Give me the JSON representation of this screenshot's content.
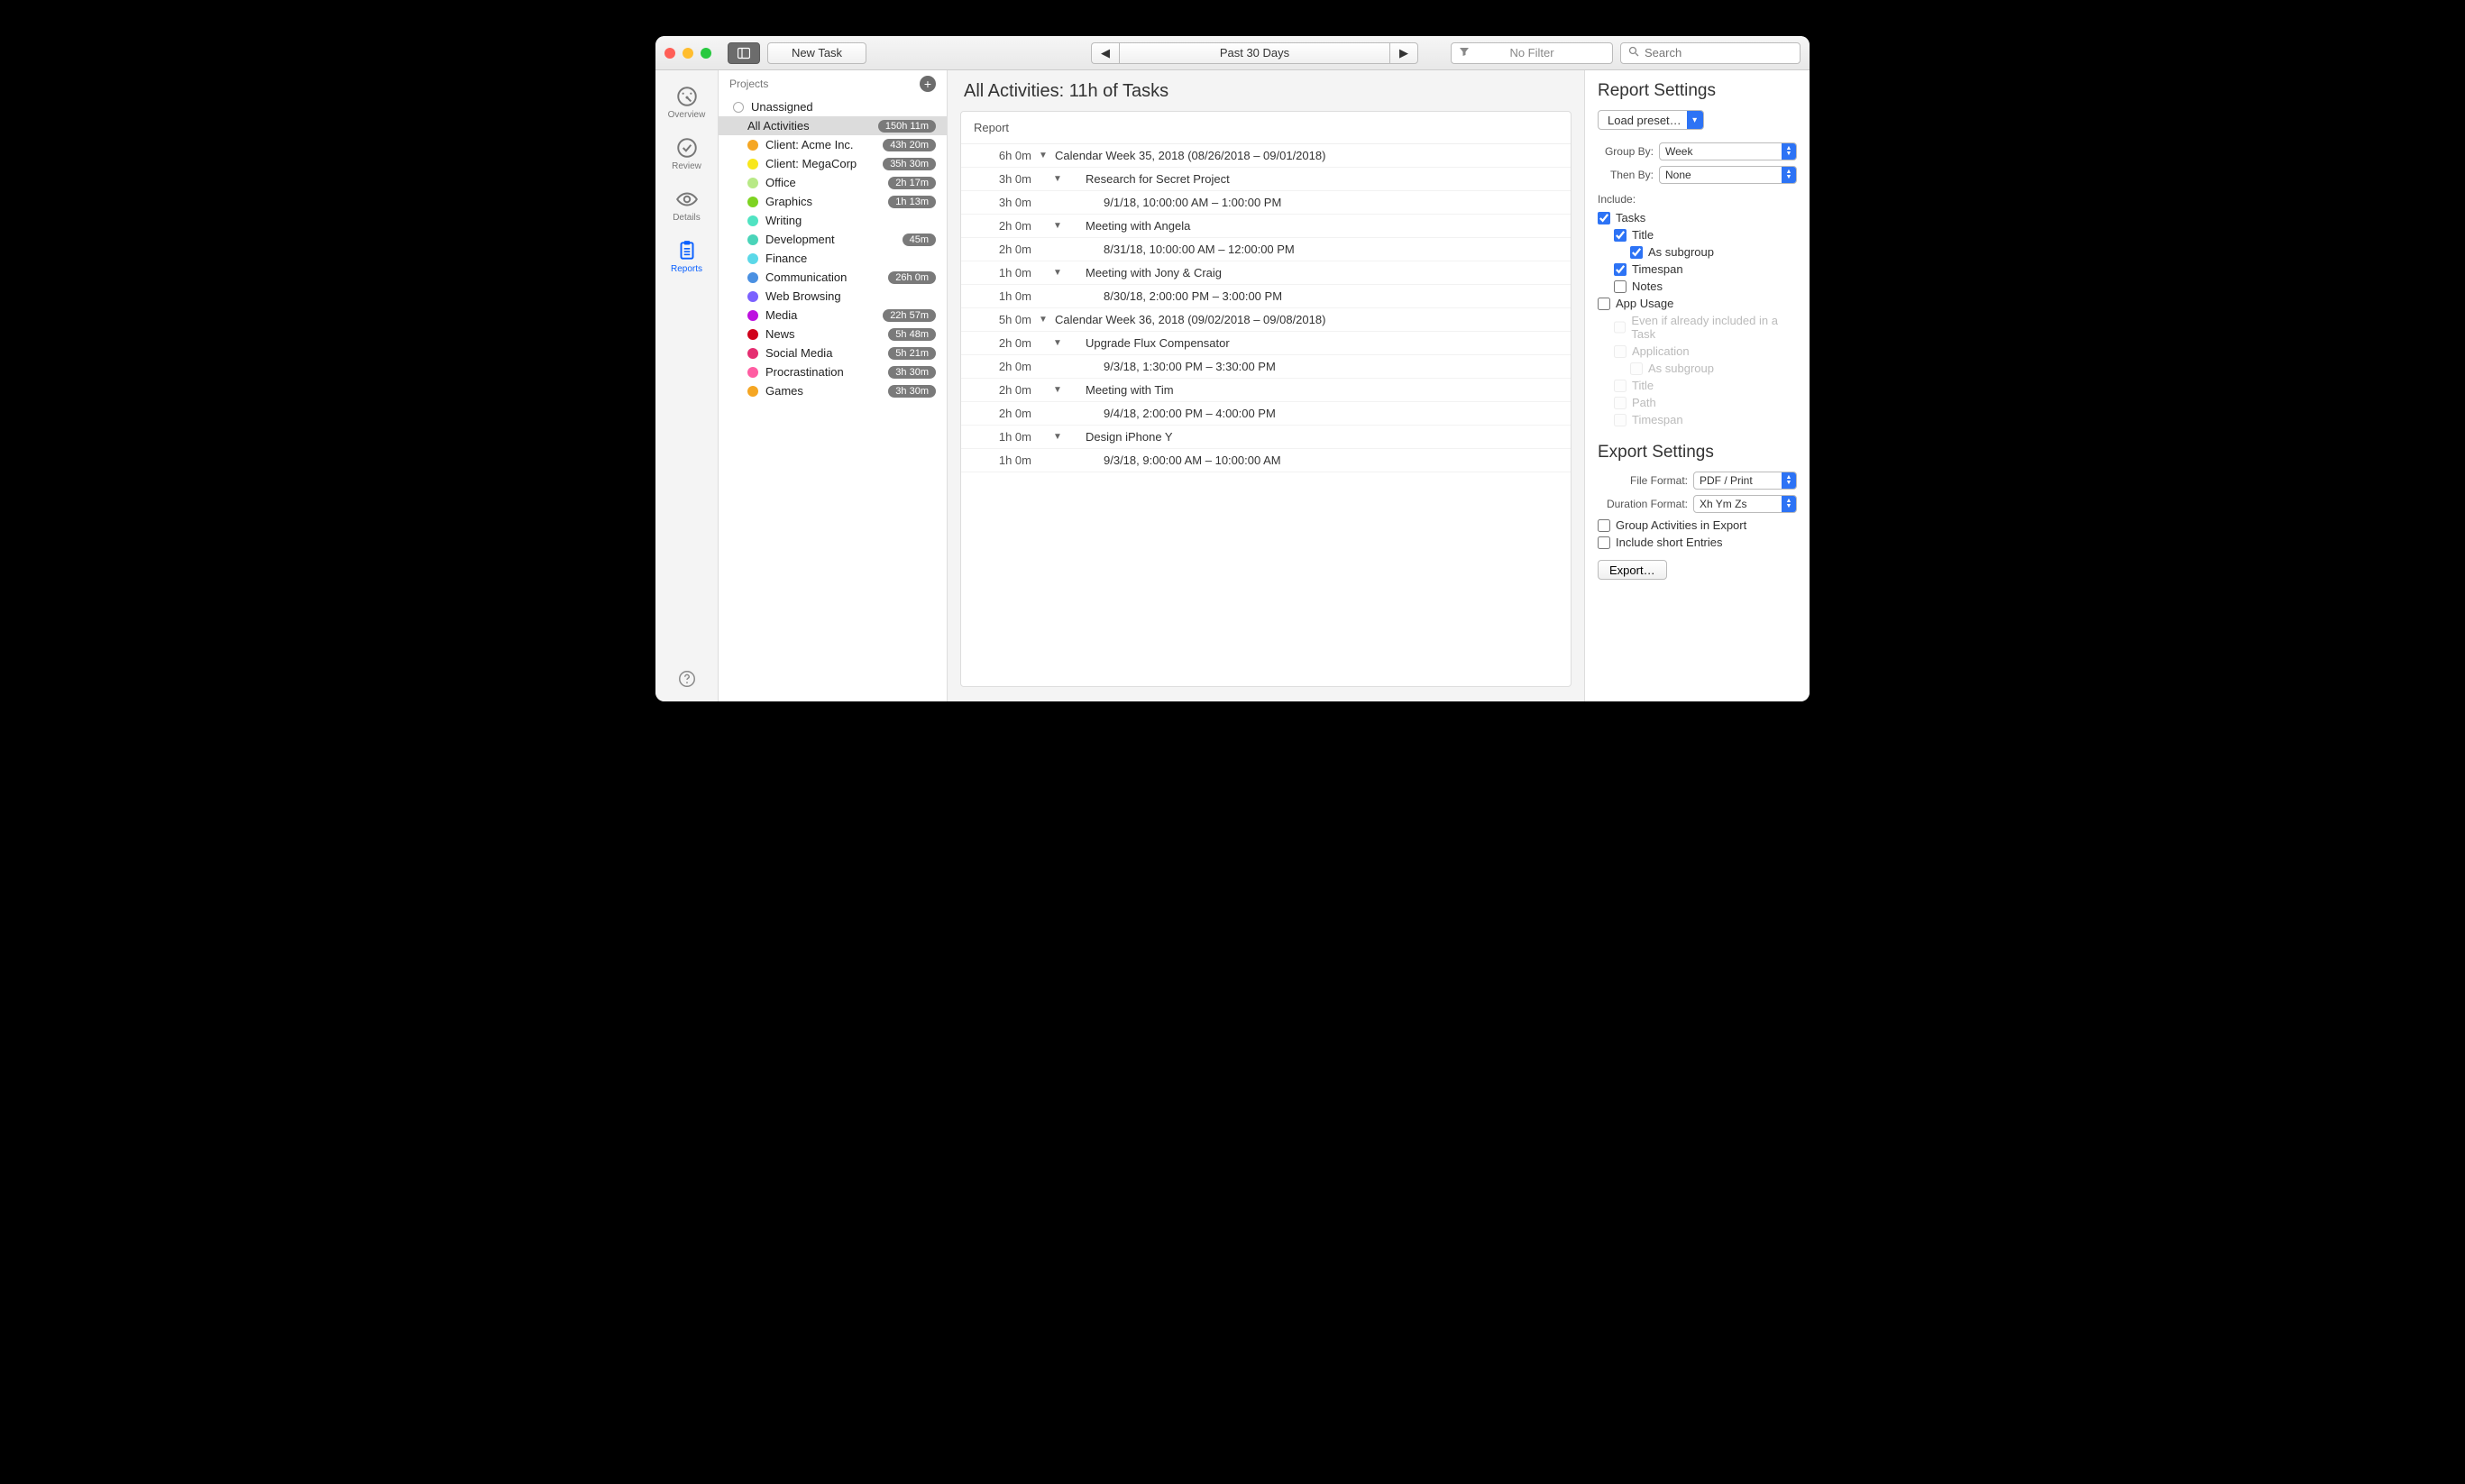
{
  "toolbar": {
    "new_task_label": "New Task",
    "prev": "◀",
    "next": "▶",
    "range_label": "Past 30 Days",
    "filter_label": "No Filter",
    "search_placeholder": "Search"
  },
  "leftnav": {
    "items": [
      {
        "id": "overview",
        "label": "Overview"
      },
      {
        "id": "review",
        "label": "Review"
      },
      {
        "id": "details",
        "label": "Details"
      },
      {
        "id": "reports",
        "label": "Reports"
      }
    ],
    "active": "reports"
  },
  "projects": {
    "header": "Projects",
    "unassigned_label": "Unassigned",
    "all_activities": {
      "label": "All Activities",
      "badge": "150h 11m"
    },
    "items": [
      {
        "label": "Client: Acme Inc.",
        "color": "#f5a623",
        "badge": "43h 20m"
      },
      {
        "label": "Client: MegaCorp",
        "color": "#f8e71c",
        "badge": "35h 30m"
      },
      {
        "label": "Office",
        "color": "#b8e986",
        "badge": "2h 17m"
      },
      {
        "label": "Graphics",
        "color": "#7ed321",
        "badge": "1h 13m"
      },
      {
        "label": "Writing",
        "color": "#50e3c2",
        "badge": ""
      },
      {
        "label": "Development",
        "color": "#4ad4b9",
        "badge": "45m"
      },
      {
        "label": "Finance",
        "color": "#5bd8e8",
        "badge": ""
      },
      {
        "label": "Communication",
        "color": "#4a90e2",
        "badge": "26h 0m"
      },
      {
        "label": "Web Browsing",
        "color": "#7b61ff",
        "badge": ""
      },
      {
        "label": "Media",
        "color": "#bd10e0",
        "badge": "22h 57m"
      },
      {
        "label": "News",
        "color": "#d0021b",
        "badge": "5h 48m"
      },
      {
        "label": "Social Media",
        "color": "#e52e71",
        "badge": "5h 21m"
      },
      {
        "label": "Procrastination",
        "color": "#ff5da2",
        "badge": "3h 30m"
      },
      {
        "label": "Games",
        "color": "#f5a623",
        "badge": "3h 30m"
      }
    ]
  },
  "main": {
    "title": "All Activities: 11h of Tasks",
    "report_header": "Report",
    "rows": [
      {
        "level": 1,
        "dur": "6h 0m",
        "disclosure": true,
        "text": "Calendar Week 35, 2018 (08/26/2018 – 09/01/2018)"
      },
      {
        "level": 2,
        "dur": "3h 0m",
        "disclosure": true,
        "text": "Research for Secret Project"
      },
      {
        "level": 3,
        "dur": "3h 0m",
        "disclosure": false,
        "text": "9/1/18, 10:00:00 AM – 1:00:00 PM"
      },
      {
        "level": 2,
        "dur": "2h 0m",
        "disclosure": true,
        "text": "Meeting with Angela"
      },
      {
        "level": 3,
        "dur": "2h 0m",
        "disclosure": false,
        "text": "8/31/18, 10:00:00 AM – 12:00:00 PM"
      },
      {
        "level": 2,
        "dur": "1h 0m",
        "disclosure": true,
        "text": "Meeting with Jony & Craig"
      },
      {
        "level": 3,
        "dur": "1h 0m",
        "disclosure": false,
        "text": "8/30/18, 2:00:00 PM – 3:00:00 PM"
      },
      {
        "level": 1,
        "dur": "5h 0m",
        "disclosure": true,
        "text": "Calendar Week 36, 2018 (09/02/2018 – 09/08/2018)"
      },
      {
        "level": 2,
        "dur": "2h 0m",
        "disclosure": true,
        "text": "Upgrade Flux Compensator"
      },
      {
        "level": 3,
        "dur": "2h 0m",
        "disclosure": false,
        "text": "9/3/18, 1:30:00 PM – 3:30:00 PM"
      },
      {
        "level": 2,
        "dur": "2h 0m",
        "disclosure": true,
        "text": "Meeting with Tim"
      },
      {
        "level": 3,
        "dur": "2h 0m",
        "disclosure": false,
        "text": "9/4/18, 2:00:00 PM – 4:00:00 PM"
      },
      {
        "level": 2,
        "dur": "1h 0m",
        "disclosure": true,
        "text": "Design iPhone Y"
      },
      {
        "level": 3,
        "dur": "1h 0m",
        "disclosure": false,
        "text": "9/3/18, 9:00:00 AM – 10:00:00 AM"
      }
    ]
  },
  "settings": {
    "report_title": "Report Settings",
    "preset_label": "Load preset…",
    "group_by_label": "Group By:",
    "group_by_value": "Week",
    "then_by_label": "Then By:",
    "then_by_value": "None",
    "include_label": "Include:",
    "checks": [
      {
        "id": "tasks",
        "label": "Tasks",
        "checked": true,
        "indent": 0,
        "disabled": false
      },
      {
        "id": "title",
        "label": "Title",
        "checked": true,
        "indent": 1,
        "disabled": false
      },
      {
        "id": "assub",
        "label": "As subgroup",
        "checked": true,
        "indent": 2,
        "disabled": false
      },
      {
        "id": "timespan",
        "label": "Timespan",
        "checked": true,
        "indent": 1,
        "disabled": false
      },
      {
        "id": "notes",
        "label": "Notes",
        "checked": false,
        "indent": 1,
        "disabled": false
      },
      {
        "id": "appusage",
        "label": "App Usage",
        "checked": false,
        "indent": 0,
        "disabled": false
      },
      {
        "id": "evenif",
        "label": "Even if already included in a Task",
        "checked": false,
        "indent": 1,
        "disabled": true
      },
      {
        "id": "application",
        "label": "Application",
        "checked": false,
        "indent": 1,
        "disabled": true
      },
      {
        "id": "assub2",
        "label": "As subgroup",
        "checked": false,
        "indent": 2,
        "disabled": true
      },
      {
        "id": "title2",
        "label": "Title",
        "checked": false,
        "indent": 1,
        "disabled": true
      },
      {
        "id": "path",
        "label": "Path",
        "checked": false,
        "indent": 1,
        "disabled": true
      },
      {
        "id": "timespan2",
        "label": "Timespan",
        "checked": false,
        "indent": 1,
        "disabled": true
      }
    ],
    "export_title": "Export Settings",
    "file_format_label": "File Format:",
    "file_format_value": "PDF / Print",
    "duration_format_label": "Duration Format:",
    "duration_format_value": "Xh Ym Zs",
    "group_activities_label": "Group Activities in Export",
    "include_short_label": "Include short Entries",
    "export_button": "Export…"
  }
}
